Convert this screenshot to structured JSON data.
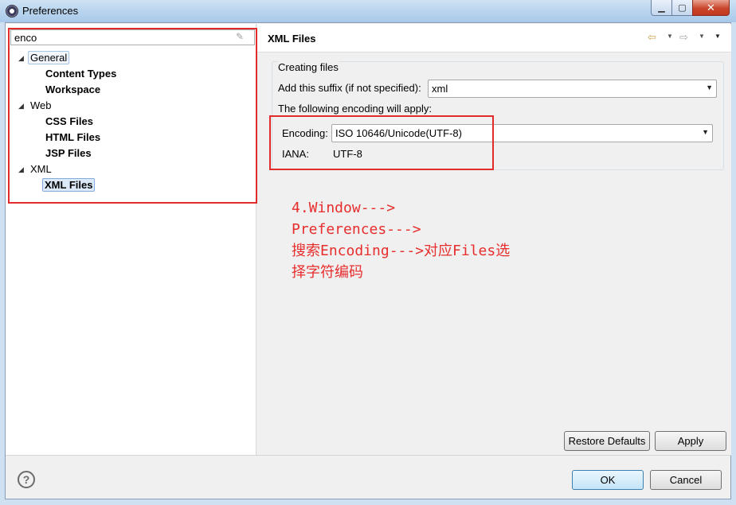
{
  "window": {
    "title": "Preferences",
    "minimize": "▁",
    "maximize": "▢",
    "close": "✕"
  },
  "filter": {
    "value": "enco",
    "clear_icon": "eraser-icon"
  },
  "tree": [
    {
      "label": "General",
      "level": 0,
      "expanded": true
    },
    {
      "label": "Content Types",
      "level": 1
    },
    {
      "label": "Workspace",
      "level": 1
    },
    {
      "label": "Web",
      "level": 0,
      "expanded": true
    },
    {
      "label": "CSS Files",
      "level": 1
    },
    {
      "label": "HTML Files",
      "level": 1
    },
    {
      "label": "JSP Files",
      "level": 1
    },
    {
      "label": "XML",
      "level": 0,
      "expanded": true
    },
    {
      "label": "XML Files",
      "level": 1,
      "selected": true
    }
  ],
  "page": {
    "title": "XML Files",
    "nav": {
      "back": "⇦",
      "forward": "⇨",
      "menu": "▼"
    }
  },
  "creating_files": {
    "legend": "Creating files",
    "suffix_label": "Add this suffix (if not specified):",
    "suffix_value": "xml",
    "encoding_intro": "The following encoding will apply:",
    "encoding_label": "Encoding:",
    "encoding_value": "ISO 10646/Unicode(UTF-8)",
    "iana_label": "IANA:",
    "iana_value": "UTF-8"
  },
  "annotation": {
    "lines": [
      "4.Window--->",
      "Preferences--->",
      "搜索Encoding--->对应Files选",
      "择字符编码"
    ],
    "color": "#e82d2d"
  },
  "buttons": {
    "restore_defaults": "Restore Defaults",
    "apply": "Apply",
    "ok": "OK",
    "cancel": "Cancel",
    "help": "?"
  },
  "colors": {
    "highlight_box": "#e32b2b",
    "selection": "#dbe9f8"
  }
}
